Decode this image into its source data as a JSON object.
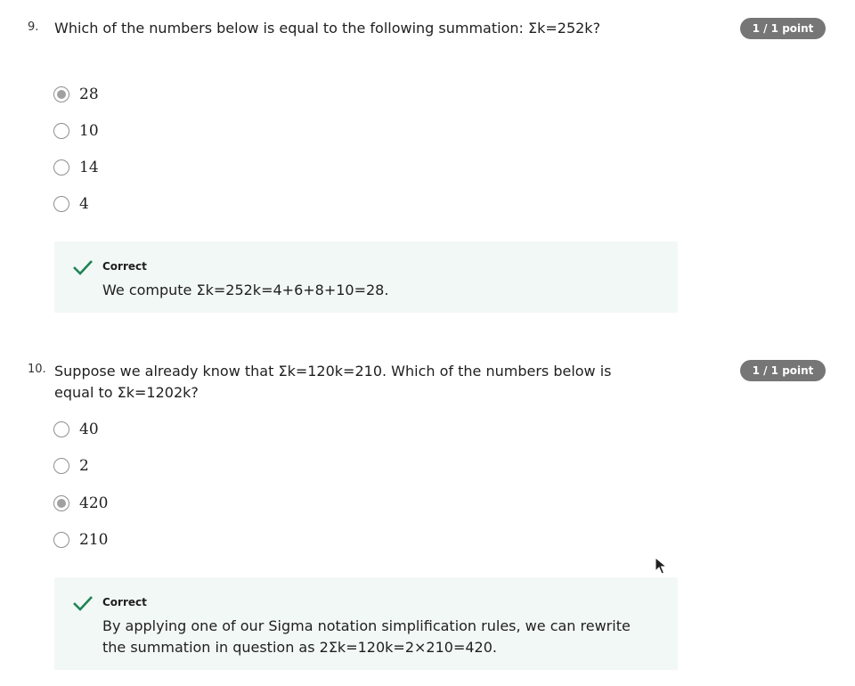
{
  "questions": [
    {
      "number": "9.",
      "text": "Which of the numbers below is equal to the following summation: Σk=252k?",
      "points": "1 / 1 point",
      "options": [
        {
          "label": "28",
          "selected": true
        },
        {
          "label": "10",
          "selected": false
        },
        {
          "label": "14",
          "selected": false
        },
        {
          "label": "4",
          "selected": false
        }
      ],
      "feedback": {
        "title": "Correct",
        "text": "We compute Σk=252k=4+6+8+10=28."
      }
    },
    {
      "number": "10.",
      "text": "Suppose we already know that Σk=120k=210. Which of the numbers below is equal to Σk=1202k?",
      "points": "1 / 1 point",
      "options": [
        {
          "label": "40",
          "selected": false
        },
        {
          "label": "2",
          "selected": false
        },
        {
          "label": "420",
          "selected": true
        },
        {
          "label": "210",
          "selected": false
        }
      ],
      "feedback": {
        "title": "Correct",
        "text": "By applying one of our Sigma notation simplification rules, we can rewrite the summation in question as 2Σk=120k=2×210=420."
      }
    }
  ],
  "colors": {
    "badge_bg": "#767676",
    "feedback_bg": "#f2f8f6",
    "check": "#1f8354",
    "radio_selected": "#a0a0a0"
  },
  "icons": {
    "check": "check-icon",
    "cursor": "mouse-cursor-icon"
  }
}
